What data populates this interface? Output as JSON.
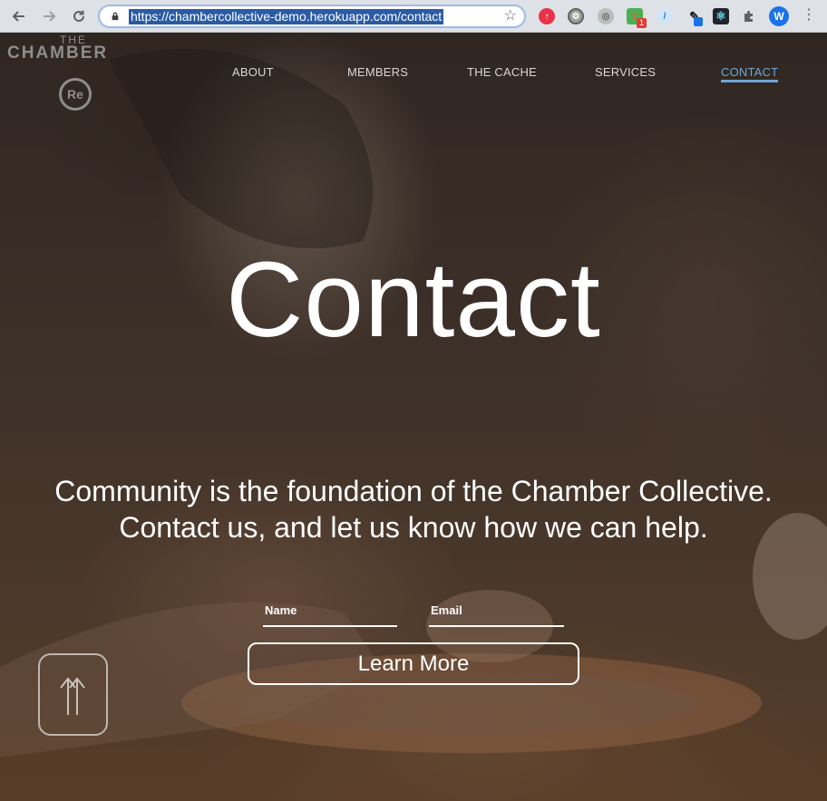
{
  "browser": {
    "url": "https://chambercollective-demo.herokuapp.com/contact",
    "extension_badge": "1",
    "profile_initial": "W"
  },
  "site": {
    "logo_top": "THE",
    "logo_name": "CHAMBER",
    "logo_mark": "Re"
  },
  "nav": {
    "items": [
      {
        "label": "ABOUT"
      },
      {
        "label": "MEMBERS"
      },
      {
        "label": "THE CACHE"
      },
      {
        "label": "SERVICES"
      },
      {
        "label": "CONTACT"
      }
    ],
    "active": "CONTACT",
    "active_color": "#6fa6d6"
  },
  "hero": {
    "title": "Contact",
    "line1": "Community is the foundation of the Chamber Collective.",
    "line2": "Contact us, and let us know how we can help."
  },
  "form": {
    "name_label": "Name",
    "email_label": "Email",
    "submit_label": "Learn More"
  },
  "icons": [
    "back-arrow-icon",
    "forward-arrow-icon",
    "reload-icon",
    "lock-icon",
    "star-icon",
    "extension-puzzle-icon",
    "menu-kebab-icon",
    "scroll-up-arrows-icon"
  ]
}
